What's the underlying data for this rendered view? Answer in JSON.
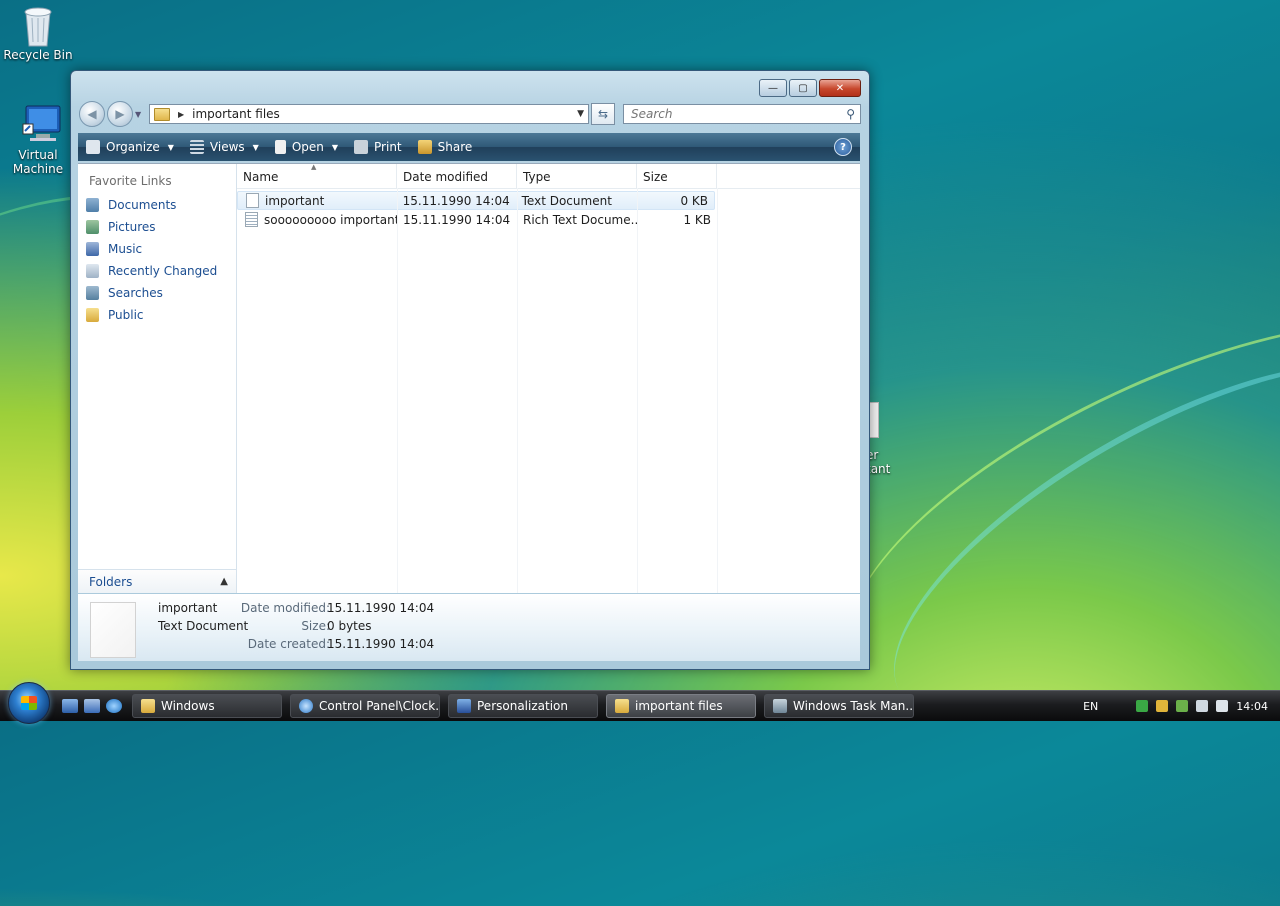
{
  "desktop": {
    "icons": [
      {
        "label": "Recycle Bin"
      },
      {
        "label": "Virtual Machine"
      }
    ],
    "partial_icon": {
      "line1": "er",
      "line2": "tant"
    }
  },
  "window": {
    "address": {
      "path": "important files"
    },
    "search": {
      "placeholder": "Search"
    },
    "toolbar": {
      "organize": "Organize",
      "views": "Views",
      "open": "Open",
      "print": "Print",
      "share": "Share",
      "help": "?"
    },
    "nav": {
      "title": "Favorite Links",
      "links": [
        "Documents",
        "Pictures",
        "Music",
        "Recently Changed",
        "Searches",
        "Public"
      ],
      "folders_label": "Folders"
    },
    "columns": [
      "Name",
      "Date modified",
      "Type",
      "Size"
    ],
    "files": [
      {
        "name": "important",
        "date": "15.11.1990 14:04",
        "type": "Text Document",
        "size": "0 KB"
      },
      {
        "name": "sooooooooo important",
        "date": "15.11.1990 14:04",
        "type": "Rich Text Docume...",
        "size": "1 KB"
      }
    ],
    "details": {
      "name": "important",
      "type": "Text Document",
      "rows": [
        {
          "label": "Date modified:",
          "value": "15.11.1990 14:04"
        },
        {
          "label": "Size:",
          "value": "0 bytes"
        },
        {
          "label": "Date created:",
          "value": "15.11.1990 14:04"
        }
      ]
    }
  },
  "taskbar": {
    "tasks": [
      {
        "label": "Windows"
      },
      {
        "label": "Control Panel\\Clock..."
      },
      {
        "label": "Personalization"
      },
      {
        "label": "important files"
      },
      {
        "label": "Windows Task Man..."
      }
    ],
    "language": "EN",
    "clock": "14:04"
  }
}
